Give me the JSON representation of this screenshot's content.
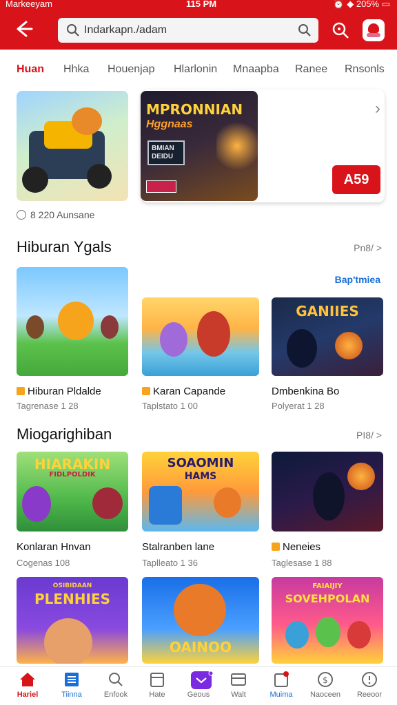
{
  "status_bar": {
    "carrier": "Markeeyam",
    "time": "115 PM",
    "battery": "205%"
  },
  "header": {
    "search_text": "Indarkapn./adam",
    "icons": [
      "back-arrow-icon",
      "search-icon",
      "magnifier-icon",
      "scan-icon",
      "cart-icon"
    ],
    "accent_color": "#d8141a"
  },
  "tabs": [
    {
      "label": "Huan",
      "active": true
    },
    {
      "label": "Hhka",
      "active": false
    },
    {
      "label": "Houenjap",
      "active": false
    },
    {
      "label": "Hlarlonin",
      "active": false
    },
    {
      "label": "Mnaapba",
      "active": false
    },
    {
      "label": "Ranee",
      "active": false
    },
    {
      "label": "Rnsonls",
      "active": false
    }
  ],
  "banner": {
    "game_title": "MPRONNIAN",
    "game_subtitle": "Hggnaas",
    "box_text": "BMIAN\nDEIDU",
    "ad_label": "A59",
    "meta": "8 220 Aunsane"
  },
  "section1": {
    "title": "Hiburan Ygals",
    "more": "Pn8/ >",
    "link": "Bap'tmiea",
    "items": [
      {
        "name": "Hiburan Pldalde",
        "sub": "Tagrenase 1 28",
        "badge": true
      },
      {
        "name": "Karan Capande",
        "sub": "Taplstato 1 00",
        "badge": true
      },
      {
        "name": "Dmbenkina Bo",
        "sub": "Polyerat 1 28",
        "badge": false,
        "art_text": "GANIIES"
      }
    ]
  },
  "section2": {
    "title": "Miogarighiban",
    "more": "PI8/ >",
    "items": [
      {
        "name": "Konlaran Hnvan",
        "sub": "Cogenas 108",
        "badge": false,
        "art_text": "HIARAKIN",
        "art_sub": "FIDLPOLDIK"
      },
      {
        "name": "Stalranben lane",
        "sub": "Taplleato 1 36",
        "badge": false,
        "art_text": "SOAOMIN",
        "art_sub": "HAMS"
      },
      {
        "name": "Neneies",
        "sub": "Taglesase 1 88",
        "badge": true
      }
    ]
  },
  "section3": {
    "items": [
      {
        "art_text": "PLENHIES",
        "art_sub": "OSIBIDAAN"
      },
      {
        "art_text": "OAINOO"
      },
      {
        "art_text": "SOVEHPOLAN",
        "art_sub": "FAIAIJIY"
      }
    ]
  },
  "bottom_nav": [
    {
      "label": "Hariel",
      "icon": "home-icon",
      "active": true
    },
    {
      "label": "Tiinna",
      "icon": "list-icon",
      "active": false
    },
    {
      "label": "Enfook",
      "icon": "search-icon",
      "active": false
    },
    {
      "label": "Hate",
      "icon": "calendar-icon",
      "active": false
    },
    {
      "label": "Geous",
      "icon": "game-icon",
      "active": false
    },
    {
      "label": "Walt",
      "icon": "wallet-icon",
      "active": false
    },
    {
      "label": "Muima",
      "icon": "notification-icon",
      "active": false
    },
    {
      "label": "Naoceen",
      "icon": "currency-icon",
      "active": false
    },
    {
      "label": "Reeoor",
      "icon": "info-icon",
      "active": false
    }
  ]
}
